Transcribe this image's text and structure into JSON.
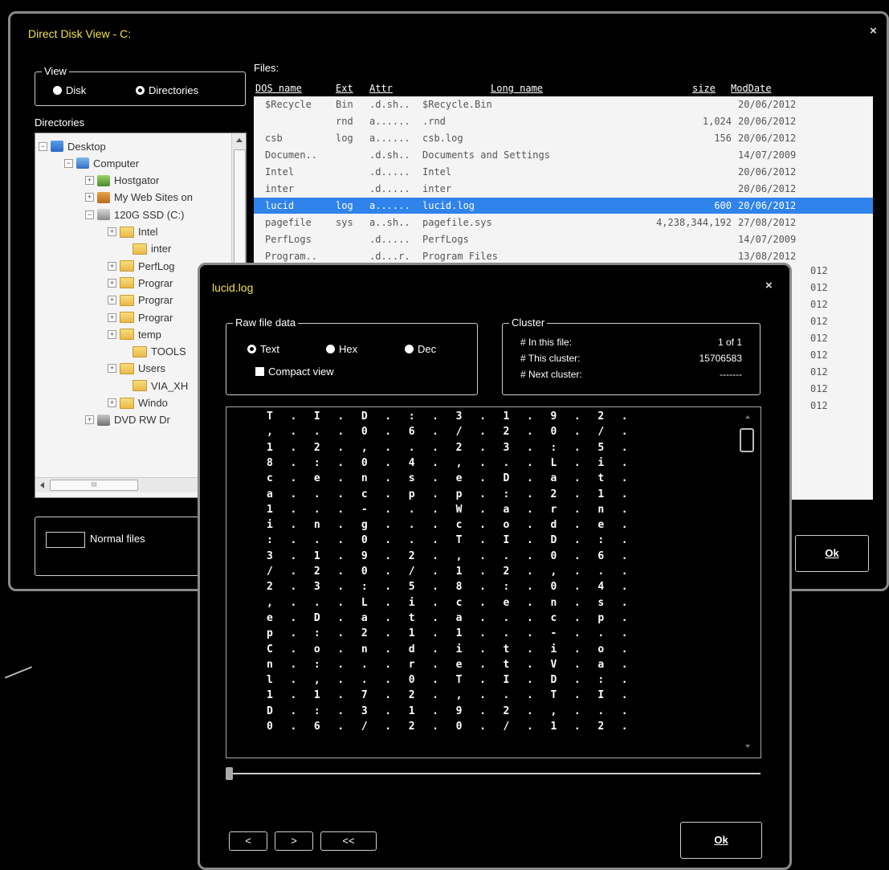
{
  "main_window": {
    "title": "Direct Disk View - C:",
    "close_glyph": "×",
    "view_frame_title": "View",
    "view_options": [
      {
        "label": "Disk",
        "selected": false
      },
      {
        "label": "Directories",
        "selected": true
      }
    ],
    "directories_label": "Directories",
    "tree": [
      {
        "label": "Desktop",
        "expander": "−",
        "icon": "desktop-icon"
      },
      {
        "label": "Computer",
        "expander": "−",
        "icon": "computer-icon"
      },
      {
        "label": "Hostgator",
        "expander": "+",
        "icon": "network-drive-icon"
      },
      {
        "label": "My Web Sites on",
        "expander": "+",
        "icon": "web-sites-icon"
      },
      {
        "label": "120G SSD (C:)",
        "expander": "−",
        "icon": "hard-drive-icon"
      },
      {
        "label": "Intel",
        "expander": "+",
        "icon": "folder-icon"
      },
      {
        "label": "inter",
        "expander": "",
        "icon": "folder-icon"
      },
      {
        "label": "PerfLog",
        "expander": "+",
        "icon": "folder-icon"
      },
      {
        "label": "Prograr",
        "expander": "+",
        "icon": "folder-icon"
      },
      {
        "label": "Prograr",
        "expander": "+",
        "icon": "folder-icon"
      },
      {
        "label": "Prograr",
        "expander": "+",
        "icon": "folder-icon"
      },
      {
        "label": "temp",
        "expander": "+",
        "icon": "folder-icon"
      },
      {
        "label": "TOOLS",
        "expander": "",
        "icon": "folder-icon"
      },
      {
        "label": "Users",
        "expander": "+",
        "icon": "folder-icon"
      },
      {
        "label": "VIA_XH",
        "expander": "",
        "icon": "folder-icon"
      },
      {
        "label": "Windo",
        "expander": "+",
        "icon": "folder-icon"
      },
      {
        "label": "DVD RW Dr",
        "expander": "+",
        "icon": "dvd-drive-icon"
      }
    ],
    "hscroll_mark": "III",
    "files_label": "Files:",
    "columns": [
      "DOS name",
      "Ext",
      "Attr",
      "Long name",
      "size",
      "ModDate"
    ],
    "files": [
      {
        "dos": "$Recycle",
        "ext": "Bin",
        "attr": ".d.sh..",
        "long": "$Recycle.Bin",
        "size": "",
        "date": "20/06/2012"
      },
      {
        "dos": "",
        "ext": "rnd",
        "attr": "a......",
        "long": ".rnd",
        "size": "1,024",
        "date": "20/06/2012"
      },
      {
        "dos": "csb",
        "ext": "log",
        "attr": "a......",
        "long": "csb.log",
        "size": "156",
        "date": "20/06/2012"
      },
      {
        "dos": "Documen..",
        "ext": "",
        "attr": ".d.sh..",
        "long": "Documents and Settings",
        "size": "",
        "date": "14/07/2009"
      },
      {
        "dos": "Intel",
        "ext": "",
        "attr": ".d.....",
        "long": "Intel",
        "size": "",
        "date": "20/06/2012"
      },
      {
        "dos": "inter",
        "ext": "",
        "attr": ".d.....",
        "long": "inter",
        "size": "",
        "date": "20/06/2012"
      },
      {
        "dos": "lucid",
        "ext": "log",
        "attr": "a......",
        "long": "lucid.log",
        "size": "600",
        "date": "20/06/2012",
        "selected": true
      },
      {
        "dos": "pagefile",
        "ext": "sys",
        "attr": "a..sh..",
        "long": "pagefile.sys",
        "size": "4,238,344,192",
        "date": "27/08/2012"
      },
      {
        "dos": "PerfLogs",
        "ext": "",
        "attr": ".d.....",
        "long": "PerfLogs",
        "size": "",
        "date": "14/07/2009"
      },
      {
        "dos": "Program..",
        "ext": "",
        "attr": ".d...r.",
        "long": "Program Files",
        "size": "",
        "date": "13/08/2012"
      }
    ],
    "hidden_date_fragments": [
      "012",
      "012",
      "012",
      "012",
      "012",
      "012",
      "012",
      "012",
      "012"
    ],
    "legend_label": "Normal files",
    "ok_label": "Ok"
  },
  "dialog": {
    "title": "lucid.log",
    "close_glyph": "×",
    "raw_frame_title": "Raw file data",
    "raw_options": [
      {
        "label": "Text",
        "selected": true
      },
      {
        "label": "Hex",
        "selected": false
      },
      {
        "label": "Dec",
        "selected": false
      }
    ],
    "compact_view_label": "Compact view",
    "cluster_frame_title": "Cluster",
    "cluster_rows": [
      {
        "label": "# In this file:",
        "value": "1 of 1"
      },
      {
        "label": "# This cluster:",
        "value": "15706583"
      },
      {
        "label": "# Next cluster:",
        "value": "-------"
      }
    ],
    "data_lines": [
      "T . I . D . : . 3 . 1 . 9 . 2 .",
      ", . . . 0 . 6 . / . 2 . 0 . / .",
      "1 . 2 . , . . . 2 . 3 . : . 5 .",
      "8 . : . 0 . 4 . , . . . L . i .",
      "c . e . n . s . e . D . a . t .",
      "a . . . c . p . p . : . 2 . 1 .",
      "1 . . . - . . . W . a . r . n .",
      "i . n . g . . . c . o . d . e .",
      ": . . . 0 . . . T . I . D . : .",
      "3 . 1 . 9 . 2 . , . . . 0 . 6 .",
      "/ . 2 . 0 . / . 1 . 2 . , . . .",
      "2 . 3 . : . 5 . 8 . : . 0 . 4 .",
      ", . . . L . i . c . e . n . s .",
      "e . D . a . t . a . . . c . p .",
      "p . : . 2 . 1 . 1 . . . - . . .",
      "C . o . n . d . i . t . i . o .",
      "n . : . . . r . e . t . V . a .",
      "l . , . . . 0 . T . I . D . : .",
      "1 . 1 . 7 . 2 . , . . . T . I .",
      "D . : . 3 . 1 . 9 . 2 . , . . .",
      "0 . 6 . / . 2 . 0 . / . 1 . 2 ."
    ],
    "nav_buttons": [
      "<",
      ">",
      "<<"
    ],
    "ok_label": "Ok"
  }
}
